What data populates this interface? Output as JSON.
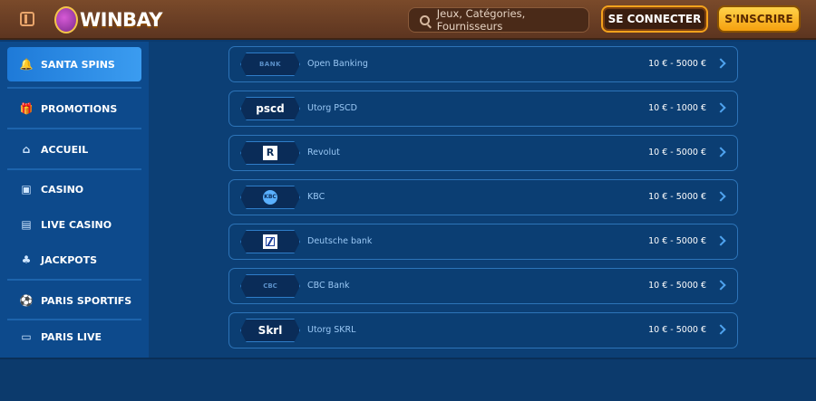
{
  "header": {
    "logo_text": "WINBAY",
    "search_placeholder": "Jeux, Catégories, Fournisseurs",
    "login_label": "SE CONNECTER",
    "signup_label": "S'INSCRIRE"
  },
  "sidebar": {
    "items": [
      {
        "label": "SANTA SPINS",
        "icon": "bell-icon"
      },
      {
        "label": "PROMOTIONS",
        "icon": "gift-icon"
      },
      {
        "label": "ACCUEIL",
        "icon": "home-icon"
      },
      {
        "label": "CASINO",
        "icon": "slot-machine-icon"
      },
      {
        "label": "LIVE CASINO",
        "icon": "cards-icon"
      },
      {
        "label": "JACKPOTS",
        "icon": "clover-icon"
      },
      {
        "label": "PARIS SPORTIFS",
        "icon": "ball-icon"
      },
      {
        "label": "PARIS LIVE",
        "icon": "live-icon"
      }
    ]
  },
  "payments": [
    {
      "name": "Open Banking",
      "range": "10 € - 5000 €",
      "logo_text": "BANK"
    },
    {
      "name": "Utorg PSCD",
      "range": "10 € - 1000 €",
      "logo_text": "pscd"
    },
    {
      "name": "Revolut",
      "range": "10 € - 5000 €",
      "logo_text": "R"
    },
    {
      "name": "KBC",
      "range": "10 € - 5000 €",
      "logo_text": "KBC"
    },
    {
      "name": "Deutsche bank",
      "range": "10 € - 5000 €",
      "logo_text": ""
    },
    {
      "name": "CBC Bank",
      "range": "10 € - 5000 €",
      "logo_text": "CBC"
    },
    {
      "name": "Utorg SKRL",
      "range": "10 € - 5000 €",
      "logo_text": "Skrl"
    }
  ]
}
